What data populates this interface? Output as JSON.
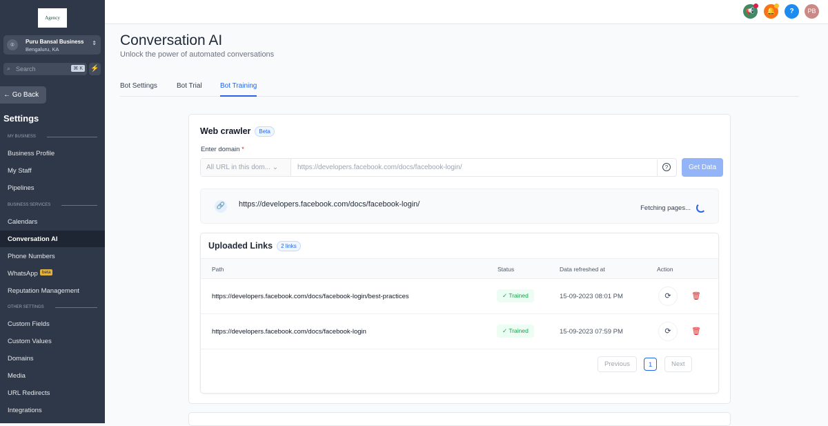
{
  "sidebar": {
    "logo_text": "Agency",
    "business_name": "Puru Bansal Business",
    "business_location": "Bengaluru, KA",
    "search_placeholder": "Search",
    "search_shortcut": "⌘ K",
    "go_back": "Go Back",
    "settings_title": "Settings",
    "sections": {
      "my_business": "MY BUSINESS",
      "business_services": "BUSINESS SERVICES",
      "other_settings": "OTHER SETTINGS"
    },
    "items": [
      "Business Profile",
      "My Staff",
      "Pipelines",
      "Calendars",
      "Conversation AI",
      "Phone Numbers",
      "WhatsApp",
      "Reputation Management",
      "Custom Fields",
      "Custom Values",
      "Domains",
      "Media",
      "URL Redirects",
      "Integrations"
    ],
    "whatsapp_badge": "beta"
  },
  "topbar": {
    "avatar_initials": "PB",
    "help": "?"
  },
  "page": {
    "title": "Conversation AI",
    "subtitle": "Unlock the power of automated conversations",
    "tabs": [
      "Bot Settings",
      "Bot Trial",
      "Bot Training"
    ],
    "active_tab": "Bot Training"
  },
  "crawler": {
    "title": "Web crawler",
    "badge": "Beta",
    "domain_label": "Enter domain",
    "required_mark": "*",
    "scope_select": "All URL in this dom...",
    "url_placeholder": "https://developers.facebook.com/docs/facebook-login/",
    "get_data": "Get Data",
    "fetching_url": "https://developers.facebook.com/docs/facebook-login/",
    "fetching_status": "Fetching pages..."
  },
  "uploaded": {
    "title": "Uploaded Links",
    "count_badge": "2 links",
    "columns": [
      "Path",
      "Status",
      "Data refreshed at",
      "Action"
    ],
    "rows": [
      {
        "path": "https://developers.facebook.com/docs/facebook-login/best-practices",
        "status": "Trained",
        "refreshed": "15-09-2023 08:01 PM"
      },
      {
        "path": "https://developers.facebook.com/docs/facebook-login",
        "status": "Trained",
        "refreshed": "15-09-2023 07:59 PM"
      }
    ],
    "pagination": {
      "previous": "Previous",
      "page": "1",
      "next": "Next"
    }
  }
}
